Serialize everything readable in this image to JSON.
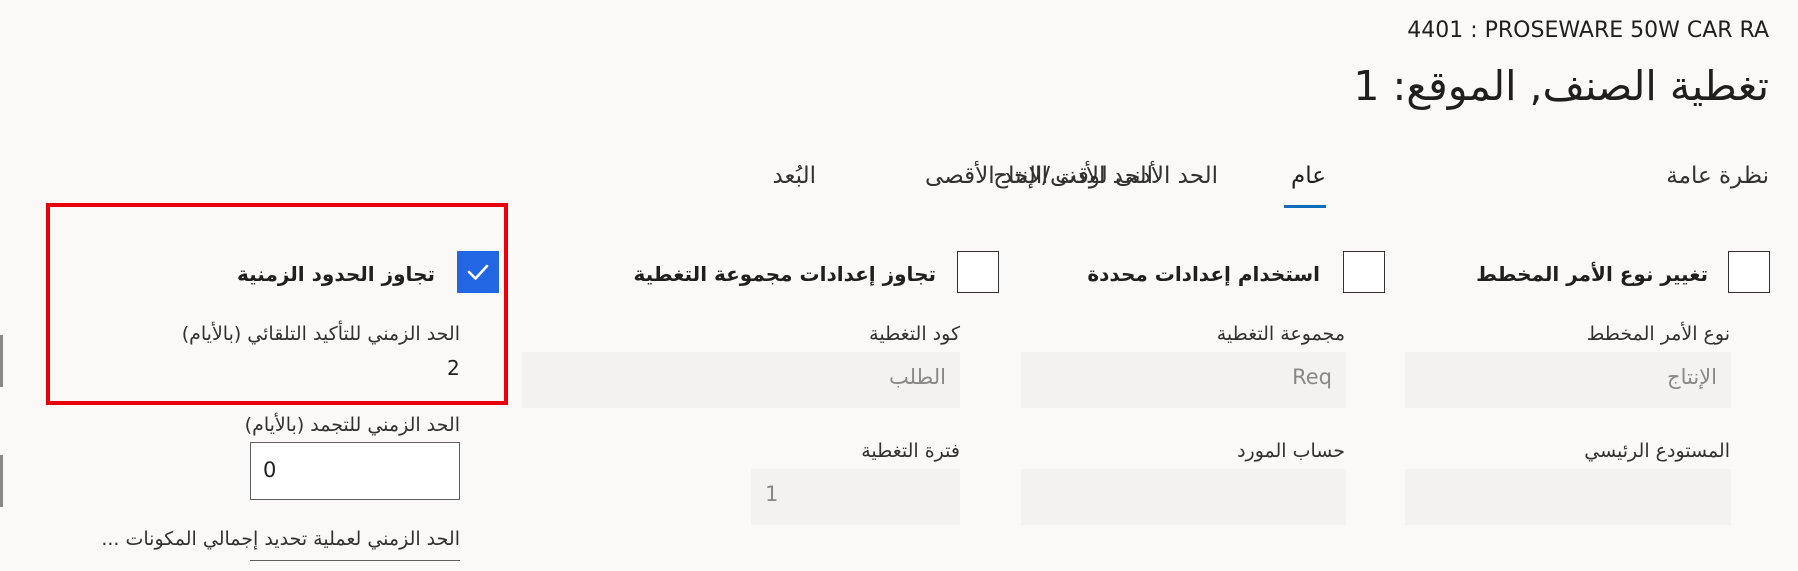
{
  "header": {
    "breadcrumb": "4401 : PROSEWARE 50W CAR RA",
    "title": "تغطية الصنف, الموقع: 1"
  },
  "tabs": [
    {
      "label": "نظرة عامة",
      "active": false
    },
    {
      "label": "عام",
      "active": true
    },
    {
      "label": "الحد الأدنى لوقت الإنتاج",
      "active": false
    },
    {
      "label": "الحد الأدنى/الحد الأقصى",
      "active": false
    },
    {
      "label": "البُعد",
      "active": false
    }
  ],
  "checkboxes": [
    {
      "label": "تغيير نوع الأمر المخطط",
      "checked": false
    },
    {
      "label": "استخدام إعدادات محددة",
      "checked": false
    },
    {
      "label": "تجاوز إعدادات مجموعة التغطية",
      "checked": false
    },
    {
      "label": "تجاوز الحدود الزمنية",
      "checked": true
    }
  ],
  "fields": {
    "planned_order_type": {
      "label": "نوع الأمر المخطط",
      "value": "الإنتاج"
    },
    "coverage_group": {
      "label": "مجموعة التغطية",
      "value": "Req"
    },
    "coverage_code": {
      "label": "كود التغطية",
      "value": "الطلب"
    },
    "main_warehouse": {
      "label": "المستودع الرئيسي",
      "value": ""
    },
    "vendor_account": {
      "label": "حساب المورد",
      "value": ""
    },
    "coverage_period": {
      "label": "فترة التغطية",
      "value": "1"
    },
    "auto_firm_fence": {
      "label": "الحد الزمني للتأكيد التلقائي (بالأيام)",
      "value": "2"
    },
    "freeze_fence": {
      "label": "الحد الزمني للتجمد (بالأيام)",
      "value": "0"
    },
    "explosion_fence": {
      "label": "الحد الزمني لعملية تحديد إجمالي المكونات ..."
    }
  }
}
